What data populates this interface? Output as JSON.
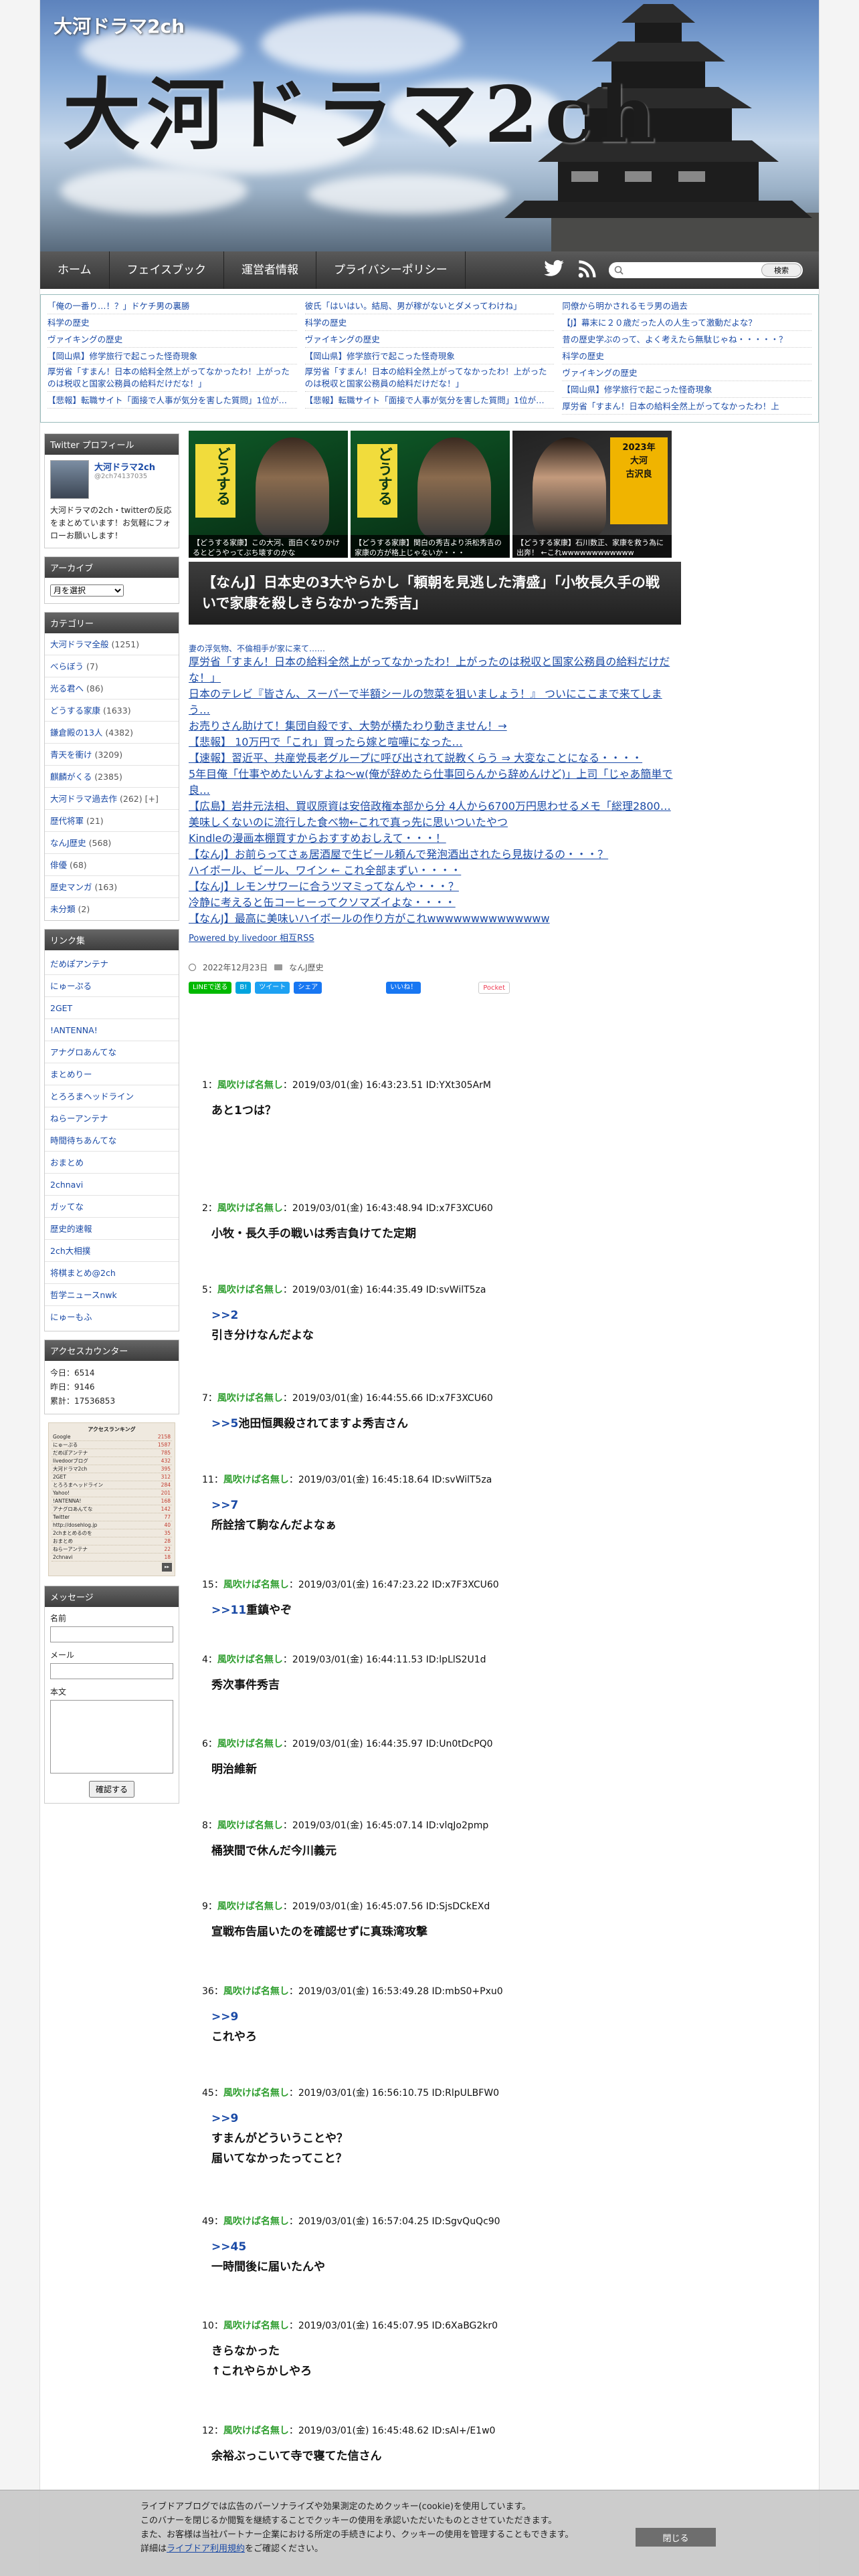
{
  "header": {
    "small_title": "大河ドラマ2ch",
    "big_title": "大河ドラマ2ch"
  },
  "nav": {
    "items": [
      "ホーム",
      "フェイスブック",
      "運営者情報",
      "プライバシーポリシー"
    ],
    "search_button": "検索"
  },
  "top_links": [
    [
      "「俺の一番り…！？」ドケチ男の裏勝",
      "科学の歴史",
      "ヴァイキングの歴史",
      "【岡山県】修学旅行で起こった怪奇現象",
      "厚労省「すまん！日本の給料全然上がってなかったわ！上がったのは税収と国家公務員の給料だけだな！」",
      "【悲報】転職サイト「面接で人事が気分を害した質問」1位が…"
    ],
    [
      "彼氏「はいはい。結局、男が稼がないとダメってわけね」",
      "科学の歴史",
      "ヴァイキングの歴史",
      "【岡山県】修学旅行で起こった怪奇現象",
      "厚労省「すまん！日本の給料全然上がってなかったわ！上がったのは税収と国家公務員の給料だけだな！」",
      "【悲報】転職サイト「面接で人事が気分を害した質問」1位が…"
    ],
    [
      "同僚から明かされるモラ男の過去",
      "【J】幕末に２０歳だった人の人生って激動だよな？",
      "昔の歴史学ぶのって、よく考えたら無駄じゃね・・・・・？",
      "科学の歴史",
      "ヴァイキングの歴史",
      "【岡山県】修学旅行で起こった怪奇現象",
      "厚労省「すまん！日本の給料全然上がってなかったわ！上"
    ]
  ],
  "sidebar": {
    "twitter": {
      "title": "Twitter プロフィール",
      "name": "大河ドラマ2ch",
      "handle": "@2ch74137035",
      "desc": "大河ドラマの2ch・twitterの反応をまとめています！お気軽にフォローお願いします！"
    },
    "archive": {
      "title": "アーカイブ",
      "select": "月を選択"
    },
    "categories": {
      "title": "カテゴリー",
      "items": [
        {
          "name": "大河ドラマ全般",
          "count": "(1251)"
        },
        {
          "name": "べらぼう",
          "count": "(7)"
        },
        {
          "name": "光る君へ",
          "count": "(86)"
        },
        {
          "name": "どうする家康",
          "count": "(1633)"
        },
        {
          "name": "鎌倉殿の13人",
          "count": "(4382)"
        },
        {
          "name": "青天を衝け",
          "count": "(3209)"
        },
        {
          "name": "麒麟がくる",
          "count": "(2385)"
        },
        {
          "name": "大河ドラマ過去作",
          "count": "(262)",
          "toggle": "[+]"
        },
        {
          "name": "歴代将軍",
          "count": "(21)"
        },
        {
          "name": "なんJ歴史",
          "count": "(568)"
        },
        {
          "name": "俳優",
          "count": "(68)"
        },
        {
          "name": "歴史マンガ",
          "count": "(163)"
        },
        {
          "name": "未分類",
          "count": "(2)"
        }
      ]
    },
    "links": {
      "title": "リンク集",
      "items": [
        "だめぽアンテナ",
        "にゅーぷる",
        "2GET",
        "!ANTENNA!",
        "アナグロあんてな",
        "まとめりー",
        "とろろまヘッドライン",
        "ねらーアンテナ",
        "時間待ちあんてな",
        "おまとめ",
        "2chnavi",
        "ガッてな",
        "歴史的速報",
        "2ch大相撲",
        "将棋まとめ@2ch",
        "哲学ニュースnwk",
        "にゅーもふ"
      ]
    },
    "counter": {
      "title": "アクセスカウンター",
      "today": "今日：6514",
      "yesterday": "昨日：9146",
      "total": "累計：17536853"
    },
    "ranking": {
      "title": "アクセスランキング",
      "rows": [
        "Google",
        "にゅーぷる",
        "だめぽアンテナ",
        "livedoorブログ",
        "大河ドラマ2ch",
        "2GET",
        "とろろまヘッドライン",
        "Yahoo!",
        "!ANTENNA!",
        "アナグロあんてな",
        "Twitter",
        "http://dosehlog.jp",
        "2chまとめるのを",
        "おまとめ",
        "ねらーアンテナ",
        "2chnavi"
      ],
      "values": [
        "2158",
        "1587",
        "785",
        "432",
        "395",
        "312",
        "284",
        "201",
        "168",
        "142",
        "77",
        "40",
        "35",
        "28",
        "22",
        "18"
      ]
    },
    "message": {
      "title": "メッセージ",
      "name": "名前",
      "mail": "メール",
      "body": "本文",
      "submit": "確認する"
    }
  },
  "main": {
    "thumbs": [
      {
        "caption": "【どうする家康】この大河、面白くなりかけるとどうやってぶち壊すのかな"
      },
      {
        "caption": "【どうする家康】関白の秀吉より浜松秀吉の家康の方が格上じゃないか・・・"
      },
      {
        "caption": "【どうする家康】石川数正、家康を救う為に出奔！ ←これwwwwwwwwwwww"
      }
    ],
    "article_title": "【なんJ】日本史の3大やらかし「頼朝を見逃した清盛」「小牧長久手の戦いで家康を殺しきらなかった秀吉」",
    "rss_first": "妻の浮気物、不倫相手が家に来て……",
    "rss_items": [
      "厚労省「すまん！日本の給料全然上がってなかったわ！上がったのは税収と国家公務員の給料だけだな！」",
      "日本のテレビ『皆さん、スーパーで半額シールの惣菜を狙いましょう！』 ついにここまで来てしまう…",
      "お売りさん助けて！集団自殺です、大勢が横たわり動きません！→",
      "【悲報】 10万円で「これ」買ったら嫁と喧嘩になった…",
      "【速報】習近平、共産党長老グループに呼び出されて説教くらう ⇒ 大変なことになる・・・・",
      "5年目俺「仕事やめたいんすよね〜w(俺が辞めたら仕事回らんから辞めんけど)」上司「じゃあ簡単で良…",
      "【広島】岩井元法相、買収原資は安倍政権本部から分 4人から6700万円思わせるメモ「総理2800…",
      "美味しくないのに流行した食べ物←これで真っ先に思いついたやつ",
      "Kindleの漫画本棚買すからおすすめおしえて・・・！",
      "【なんJ】お前らってさぁ居酒屋で生ビール頼んで発泡酒出されたら見抜けるの・・・？",
      "ハイボール、ビール、ワイン ← これ全部まずい・・・・",
      "【なんJ】レモンサワーに合うツマミってなんや・・・？",
      "冷静に考えると缶コーヒーってクソマズイよな・・・・",
      "【なんJ】最高に美味いハイボールの作り方がこれwwwwwwwwwwwwww"
    ],
    "rss_powered": "Powered by livedoor 相互RSS",
    "date": "2022年12月23日",
    "category": "なんJ歴史",
    "share": [
      "LINEで送る",
      "B!",
      "ツイート",
      "シェア",
      "いいね！",
      "Pocket"
    ],
    "posts": [
      {
        "num": "1：",
        "name": "風吹けば名無し",
        "info": "：2019/03/01(金) 16:43:23.51 ID:YXt305ArM",
        "lines": [
          "あと1つは？"
        ]
      },
      {
        "num": "2：",
        "name": "風吹けば名無し",
        "info": "：2019/03/01(金) 16:43:48.94 ID:x7F3XCU60",
        "lines": [
          "小牧・長久手の戦いは秀吉負けてた定期"
        ]
      },
      {
        "num": "5：",
        "name": "風吹けば名無し",
        "info": "：2019/03/01(金) 16:44:35.49 ID:svWilT5za",
        "anchor": ">>2",
        "lines": [
          "引き分けなんだよな"
        ]
      },
      {
        "num": "7：",
        "name": "風吹けば名無し",
        "info": "：2019/03/01(金) 16:44:55.66 ID:x7F3XCU60",
        "anchor": ">>5",
        "inline": "池田恒興殺されてますよ秀吉さん"
      },
      {
        "num": "11：",
        "name": "風吹けば名無し",
        "info": "：2019/03/01(金) 16:45:18.64 ID:svWilT5za",
        "anchor": ">>7",
        "lines": [
          "所詮捨て駒なんだよなぁ"
        ]
      },
      {
        "num": "15：",
        "name": "風吹けば名無し",
        "info": "：2019/03/01(金) 16:47:23.22 ID:x7F3XCU60",
        "anchor": ">>11",
        "inline": "重鎮やぞ"
      },
      {
        "num": "4：",
        "name": "風吹けば名無し",
        "info": "：2019/03/01(金) 16:44:11.53 ID:lpLlS2U1d",
        "lines": [
          "秀次事件秀吉"
        ]
      },
      {
        "num": "6：",
        "name": "風吹けば名無し",
        "info": "：2019/03/01(金) 16:44:35.97 ID:Un0tDcPQ0",
        "lines": [
          "明治維新"
        ]
      },
      {
        "num": "8：",
        "name": "風吹けば名無し",
        "info": "：2019/03/01(金) 16:45:07.14 ID:vlqJo2pmp",
        "lines": [
          "桶狭間で休んだ今川義元"
        ]
      },
      {
        "num": "9：",
        "name": "風吹けば名無し",
        "info": "：2019/03/01(金) 16:45:07.56 ID:SjsDCkEXd",
        "lines": [
          "宣戦布告届いたのを確認せずに真珠湾攻撃"
        ]
      },
      {
        "num": "36：",
        "name": "風吹けば名無し",
        "info": "：2019/03/01(金) 16:53:49.28 ID:mbS0+Pxu0",
        "anchor": ">>9",
        "lines": [
          "これやろ"
        ]
      },
      {
        "num": "45：",
        "name": "風吹けば名無し",
        "info": "：2019/03/01(金) 16:56:10.75 ID:RlpULBFW0",
        "anchor": ">>9",
        "lines": [
          "すまんがどういうことや？",
          "届いてなかったってこと？"
        ]
      },
      {
        "num": "49：",
        "name": "風吹けば名無し",
        "info": "：2019/03/01(金) 16:57:04.25 ID:SgvQuQc90",
        "anchor": ">>45",
        "lines": [
          "一時間後に届いたんや"
        ]
      },
      {
        "num": "10：",
        "name": "風吹けば名無し",
        "info": "：2019/03/01(金) 16:45:07.95 ID:6XaBG2kr0",
        "lines": [
          "きらなかった",
          "↑これやらかしやろ"
        ]
      },
      {
        "num": "12：",
        "name": "風吹けば名無し",
        "info": "：2019/03/01(金) 16:45:48.62 ID:sAl+/E1w0",
        "lines": [
          "余裕ぶっこいて寺で寝てた信さん"
        ]
      }
    ]
  },
  "cookie": {
    "line1": "ライブドアブログでは広告のパーソナライズや効果測定のためクッキー(cookie)を使用しています。",
    "line2": "このバナーを閉じるか閲覧を継続することでクッキーの使用を承認いただいたものとさせていただきます。",
    "line3": "また、お客様は当社パートナー企業における所定の手続きにより、クッキーの使用を管理することもできます。",
    "line4_pre": "詳細は",
    "line4_link": "ライブドア利用規約",
    "line4_post": "をご確認ください。",
    "close": "閉じる"
  }
}
